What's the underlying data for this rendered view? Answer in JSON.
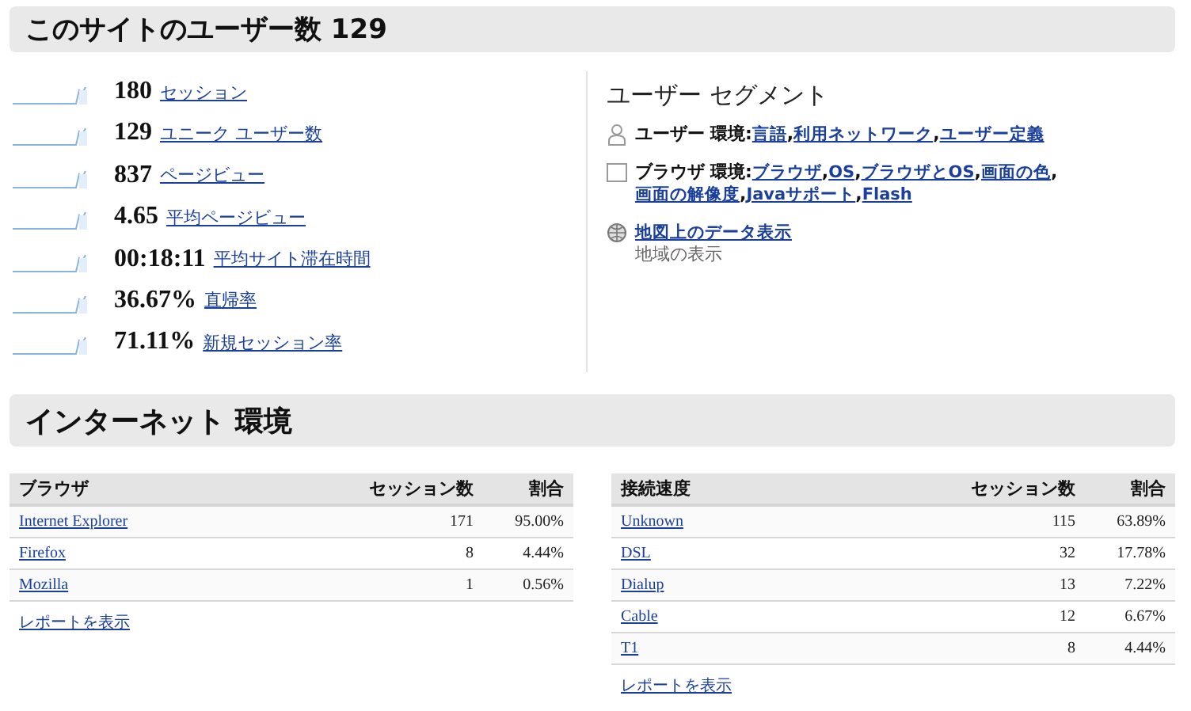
{
  "site_summary": {
    "title": "このサイトのユーザー数 129",
    "metrics": [
      {
        "value": "180",
        "label": "セッション"
      },
      {
        "value": "129",
        "label": "ユニーク ユーザー数"
      },
      {
        "value": "837",
        "label": "ページビュー"
      },
      {
        "value": "4.65",
        "label": "平均ページビュー"
      },
      {
        "value": "00:18:11",
        "label": "平均サイト滞在時間"
      },
      {
        "value": "36.67%",
        "label": "直帰率"
      },
      {
        "value": "71.11%",
        "label": "新規セッション率"
      }
    ],
    "segments": {
      "title": "ユーザー セグメント",
      "items": [
        {
          "kind": "user",
          "name": "ユーザー",
          "prefix": "環境:",
          "separator": ",",
          "links": [
            "言語",
            "利用ネットワーク",
            "ユーザー定義"
          ]
        },
        {
          "kind": "browser",
          "name": "ブラウザ",
          "prefix": "環境:",
          "separator": ",",
          "links": [
            "ブラウザ",
            "OS",
            "ブラウザとOS",
            "画面の色",
            "画面の解像度",
            "Javaサポート",
            "Flash"
          ]
        },
        {
          "kind": "map",
          "link": "地図上のデータ表示",
          "note": "地域の表示"
        }
      ]
    }
  },
  "internet": {
    "title": "インターネット 環境",
    "tables": [
      {
        "columns": [
          "ブラウザ",
          "セッション数",
          "割合"
        ],
        "rows": [
          [
            "Internet Explorer",
            "171",
            "95.00%"
          ],
          [
            "Firefox",
            "8",
            "4.44%"
          ],
          [
            "Mozilla",
            "1",
            "0.56%"
          ]
        ],
        "report_link": "レポートを表示"
      },
      {
        "columns": [
          "接続速度",
          "セッション数",
          "割合"
        ],
        "rows": [
          [
            "Unknown",
            "115",
            "63.89%"
          ],
          [
            "DSL",
            "32",
            "17.78%"
          ],
          [
            "Dialup",
            "13",
            "7.22%"
          ],
          [
            "Cable",
            "12",
            "6.67%"
          ],
          [
            "T1",
            "8",
            "4.44%"
          ]
        ],
        "report_link": "レポートを表示"
      }
    ]
  }
}
